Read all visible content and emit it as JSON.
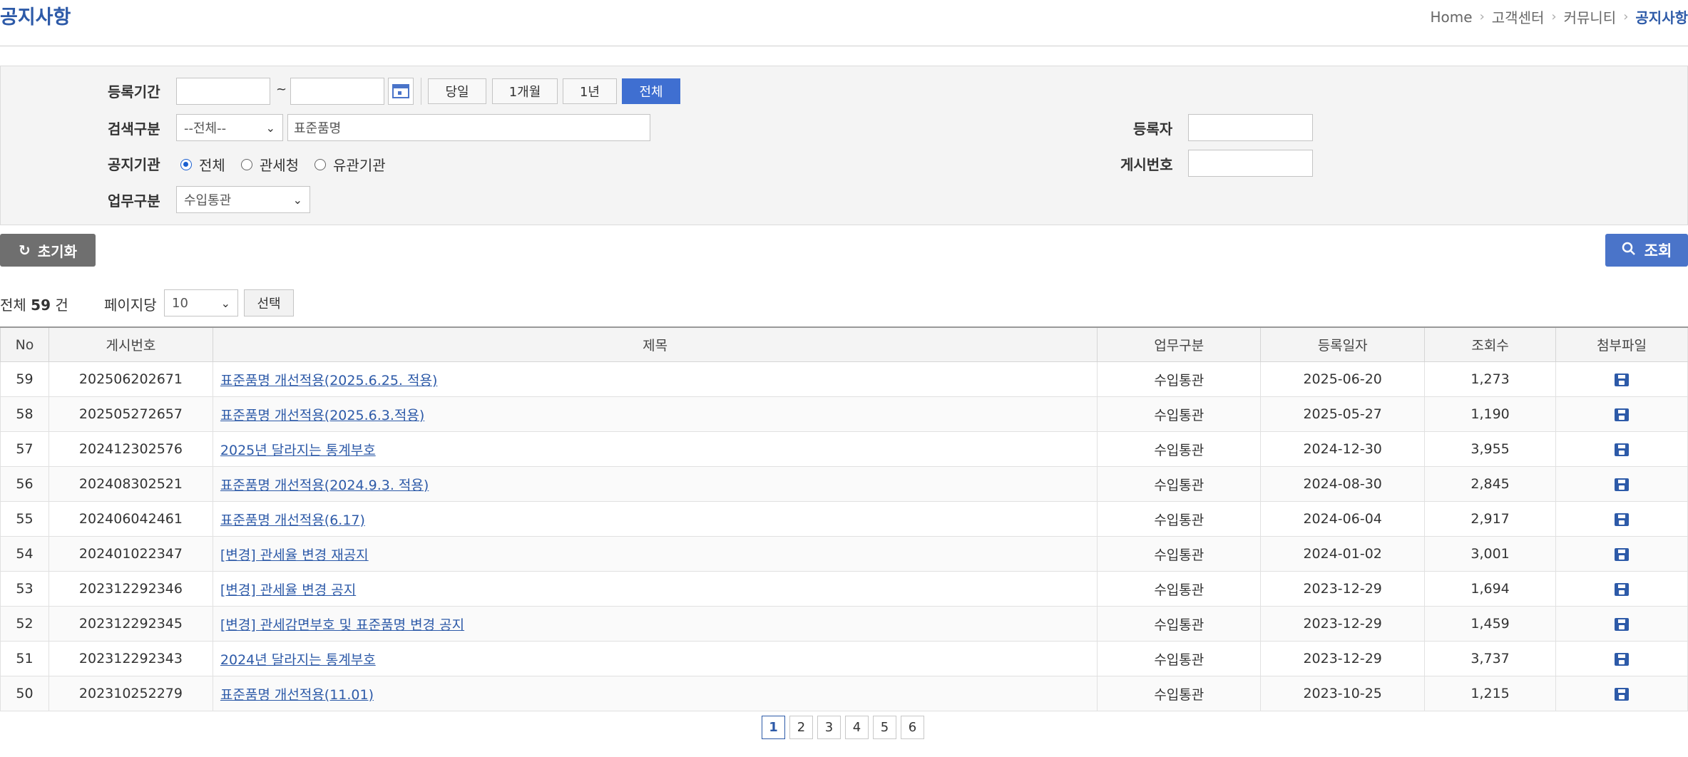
{
  "header": {
    "title": "공지사항",
    "breadcrumb": [
      "Home",
      "고객센터",
      "커뮤니티",
      "공지사항"
    ]
  },
  "search": {
    "period_label": "등록기간",
    "date_from": "",
    "date_to": "",
    "tilde": "~",
    "period_buttons": [
      "당일",
      "1개월",
      "1년",
      "전체"
    ],
    "period_active": "전체",
    "type_label": "검색구분",
    "type_select": "--전체--",
    "keyword": "표준품명",
    "agency_label": "공지기관",
    "agency_options": [
      "전체",
      "관세청",
      "유관기관"
    ],
    "agency_selected": "전체",
    "work_label": "업무구분",
    "work_select": "수입통관",
    "registrant_label": "등록자",
    "registrant_value": "",
    "post_no_label": "게시번호",
    "post_no_value": ""
  },
  "actions": {
    "reset_label": "초기화",
    "search_label": "조회"
  },
  "list_info": {
    "total_prefix": "전체",
    "total_count": "59",
    "total_suffix": "건",
    "per_page_label": "페이지당",
    "per_page_value": "10",
    "select_label": "선택"
  },
  "table": {
    "columns": [
      "No",
      "게시번호",
      "제목",
      "업무구분",
      "등록일자",
      "조회수",
      "첨부파일"
    ],
    "rows": [
      {
        "no": "59",
        "post_no": "202506202671",
        "title": "표준품명 개선적용(2025.6.25. 적용)",
        "category": "수입통관",
        "date": "2025-06-20",
        "views": "1,273"
      },
      {
        "no": "58",
        "post_no": "202505272657",
        "title": "표준품명 개선적용(2025.6.3.적용)",
        "category": "수입통관",
        "date": "2025-05-27",
        "views": "1,190"
      },
      {
        "no": "57",
        "post_no": "202412302576",
        "title": "2025년 달라지는 통계부호",
        "category": "수입통관",
        "date": "2024-12-30",
        "views": "3,955"
      },
      {
        "no": "56",
        "post_no": "202408302521",
        "title": "표준품명 개선적용(2024.9.3. 적용)",
        "category": "수입통관",
        "date": "2024-08-30",
        "views": "2,845"
      },
      {
        "no": "55",
        "post_no": "202406042461",
        "title": "표준품명 개선적용(6.17)",
        "category": "수입통관",
        "date": "2024-06-04",
        "views": "2,917"
      },
      {
        "no": "54",
        "post_no": "202401022347",
        "title": "[변경] 관세율 변경 재공지",
        "category": "수입통관",
        "date": "2024-01-02",
        "views": "3,001"
      },
      {
        "no": "53",
        "post_no": "202312292346",
        "title": "[변경] 관세율 변경 공지",
        "category": "수입통관",
        "date": "2023-12-29",
        "views": "1,694"
      },
      {
        "no": "52",
        "post_no": "202312292345",
        "title": "[변경] 관세감면부호 및 표준품명 변경 공지",
        "category": "수입통관",
        "date": "2023-12-29",
        "views": "1,459"
      },
      {
        "no": "51",
        "post_no": "202312292343",
        "title": "2024년 달라지는 통계부호",
        "category": "수입통관",
        "date": "2023-12-29",
        "views": "3,737"
      },
      {
        "no": "50",
        "post_no": "202310252279",
        "title": "표준품명 개선적용(11.01)",
        "category": "수입통관",
        "date": "2023-10-25",
        "views": "1,215"
      }
    ]
  },
  "pagination": {
    "pages": [
      "1",
      "2",
      "3",
      "4",
      "5",
      "6"
    ],
    "current": "1"
  },
  "colors": {
    "accent": "#4a74c9",
    "title": "#2d5aa8",
    "reset_button": "#6f6f6f"
  }
}
